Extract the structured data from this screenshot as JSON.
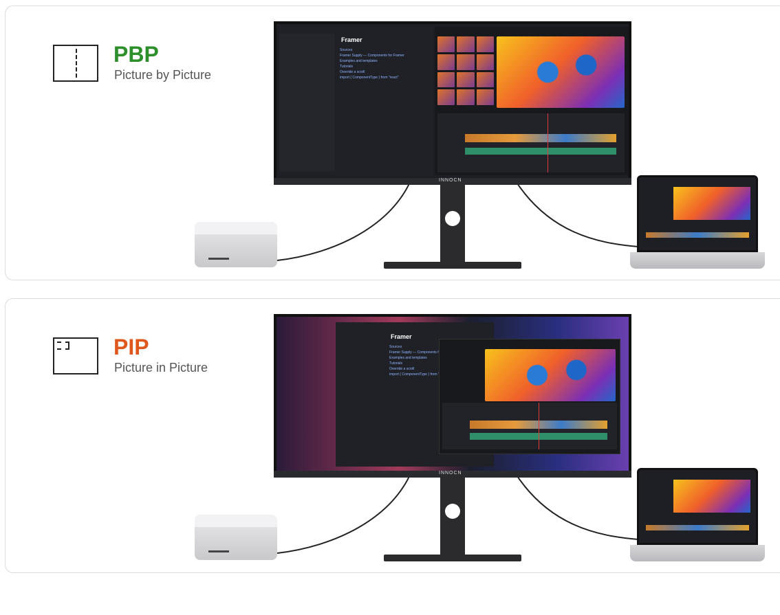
{
  "sections": [
    {
      "id": "pbp",
      "icon": "split-screen-icon",
      "title": "PBP",
      "subtitle": "Picture by Picture",
      "title_color": "#2c8f2a"
    },
    {
      "id": "pip",
      "icon": "pip-screen-icon",
      "title": "PIP",
      "subtitle": "Picture in Picture",
      "title_color": "#e0571e"
    }
  ],
  "monitor": {
    "brand": "INNOCN"
  },
  "screen": {
    "code_title": "Framer",
    "code_lines": [
      "Sources",
      "Framer Supply — Components for Framer",
      "Examples and templates",
      "Tutorials",
      "Override a scroll",
      "import { ComponentType } from \"react\""
    ]
  }
}
